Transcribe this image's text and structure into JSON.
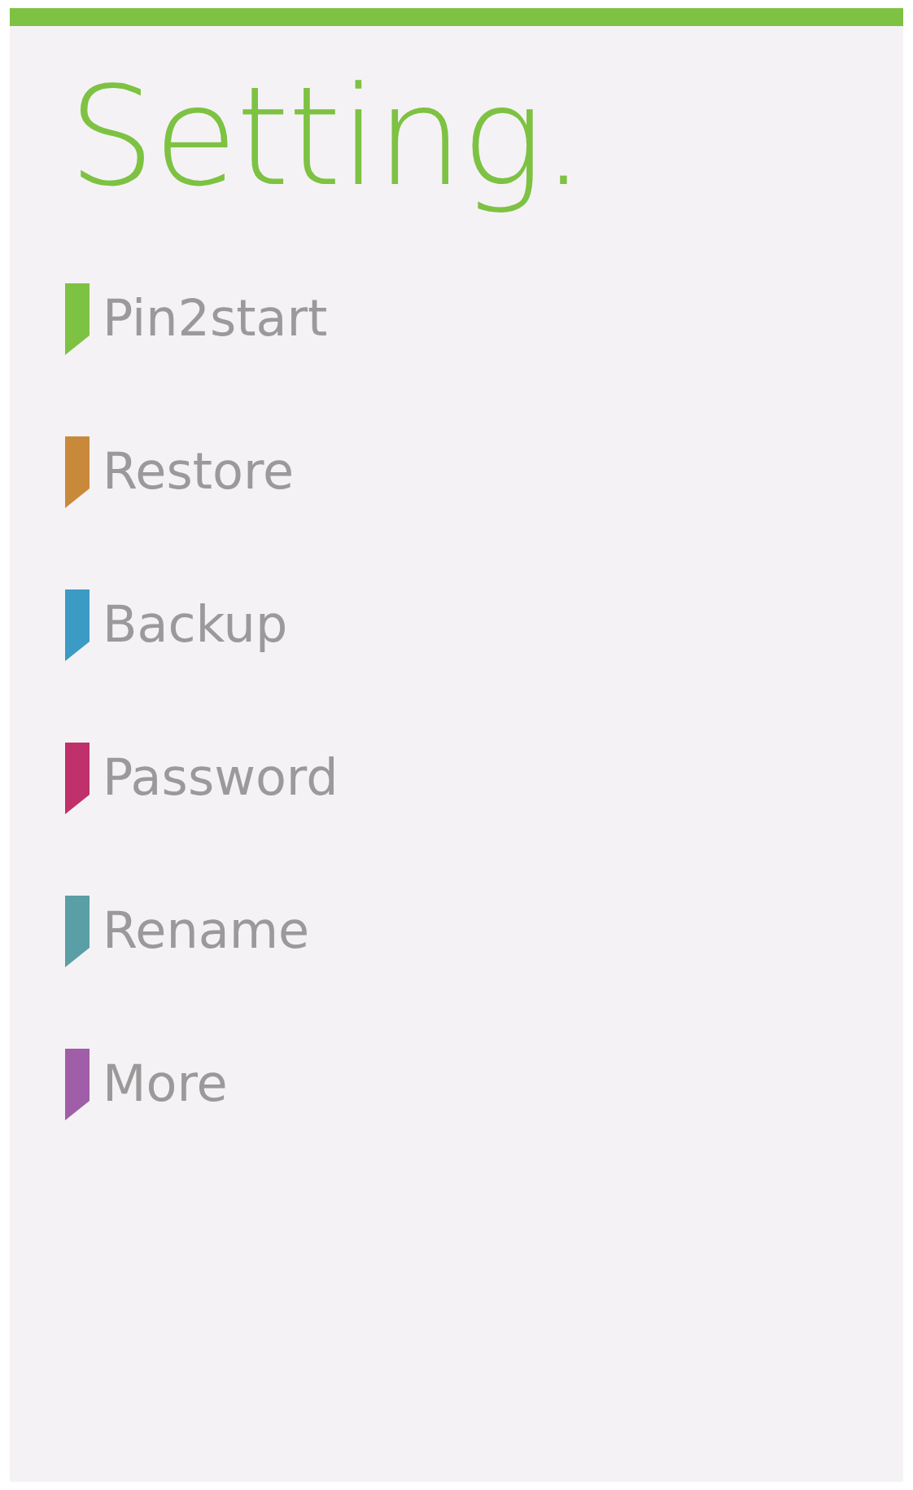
{
  "title": "Setting.",
  "items": [
    {
      "label": "Pin2start",
      "color": "#7dc242"
    },
    {
      "label": "Restore",
      "color": "#c8893a"
    },
    {
      "label": "Backup",
      "color": "#3b9bc4"
    },
    {
      "label": "Password",
      "color": "#c0306a"
    },
    {
      "label": "Rename",
      "color": "#5a9ea6"
    },
    {
      "label": "More",
      "color": "#a15ea8"
    }
  ]
}
